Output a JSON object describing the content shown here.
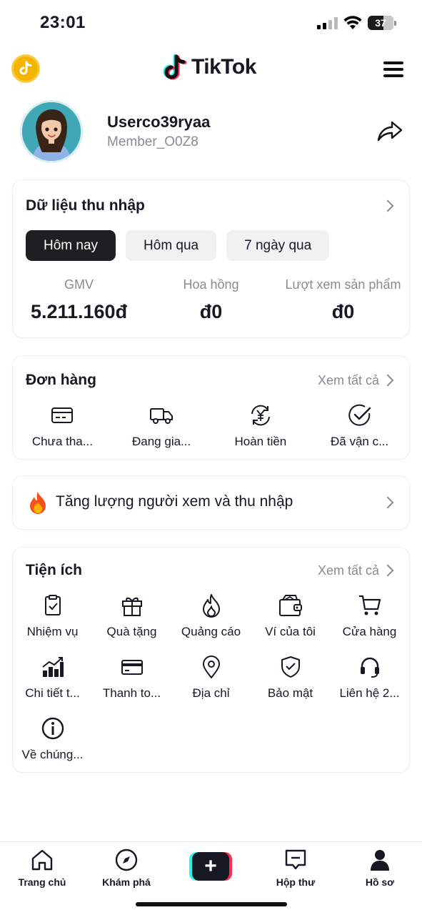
{
  "status_bar": {
    "time": "23:01",
    "battery": "37"
  },
  "header": {
    "brand": "TikTok"
  },
  "profile": {
    "username": "Userco39ryaa",
    "member_id": "Member_O0Z8"
  },
  "earnings": {
    "title": "Dữ liệu thu nhập",
    "tabs": [
      {
        "label": "Hôm nay",
        "active": true
      },
      {
        "label": "Hôm qua",
        "active": false
      },
      {
        "label": "7 ngày qua",
        "active": false
      }
    ],
    "metrics": [
      {
        "label": "GMV",
        "value": "5.211.160đ"
      },
      {
        "label": "Hoa hồng",
        "value": "đ0"
      },
      {
        "label": "Lượt xem sản phẩm",
        "value": "đ0"
      }
    ]
  },
  "orders": {
    "title": "Đơn hàng",
    "see_all": "Xem tất cả",
    "items": [
      {
        "label": "Chưa tha...",
        "icon": "card-icon"
      },
      {
        "label": "Đang gia...",
        "icon": "truck-icon"
      },
      {
        "label": "Hoàn tiền",
        "icon": "refund-icon"
      },
      {
        "label": "Đã vận c...",
        "icon": "check-circle-icon"
      }
    ]
  },
  "promo": {
    "label": "Tăng lượng người xem và thu nhập",
    "icon": "fire-icon"
  },
  "utilities": {
    "title": "Tiện ích",
    "see_all": "Xem tất cả",
    "items": [
      {
        "label": "Nhiệm vụ",
        "icon": "task-icon"
      },
      {
        "label": "Quà tặng",
        "icon": "gift-icon"
      },
      {
        "label": "Quảng cáo",
        "icon": "flame-icon"
      },
      {
        "label": "Ví của tôi",
        "icon": "wallet-icon"
      },
      {
        "label": "Cửa hàng",
        "icon": "cart-icon"
      },
      {
        "label": "Chi tiết t...",
        "icon": "chart-icon"
      },
      {
        "label": "Thanh to...",
        "icon": "payment-card-icon"
      },
      {
        "label": "Địa chỉ",
        "icon": "location-icon"
      },
      {
        "label": "Bảo mật",
        "icon": "shield-icon"
      },
      {
        "label": "Liên hệ 2...",
        "icon": "headset-icon"
      },
      {
        "label": "Về chúng...",
        "icon": "info-icon"
      }
    ]
  },
  "bottom_nav": {
    "items": [
      {
        "label": "Trang chủ",
        "icon": "home-icon"
      },
      {
        "label": "Khám phá",
        "icon": "compass-icon"
      },
      {
        "label": "",
        "icon": "plus-icon"
      },
      {
        "label": "Hộp thư",
        "icon": "inbox-icon"
      },
      {
        "label": "Hồ sơ",
        "icon": "profile-icon"
      }
    ],
    "create_symbol": "+"
  }
}
